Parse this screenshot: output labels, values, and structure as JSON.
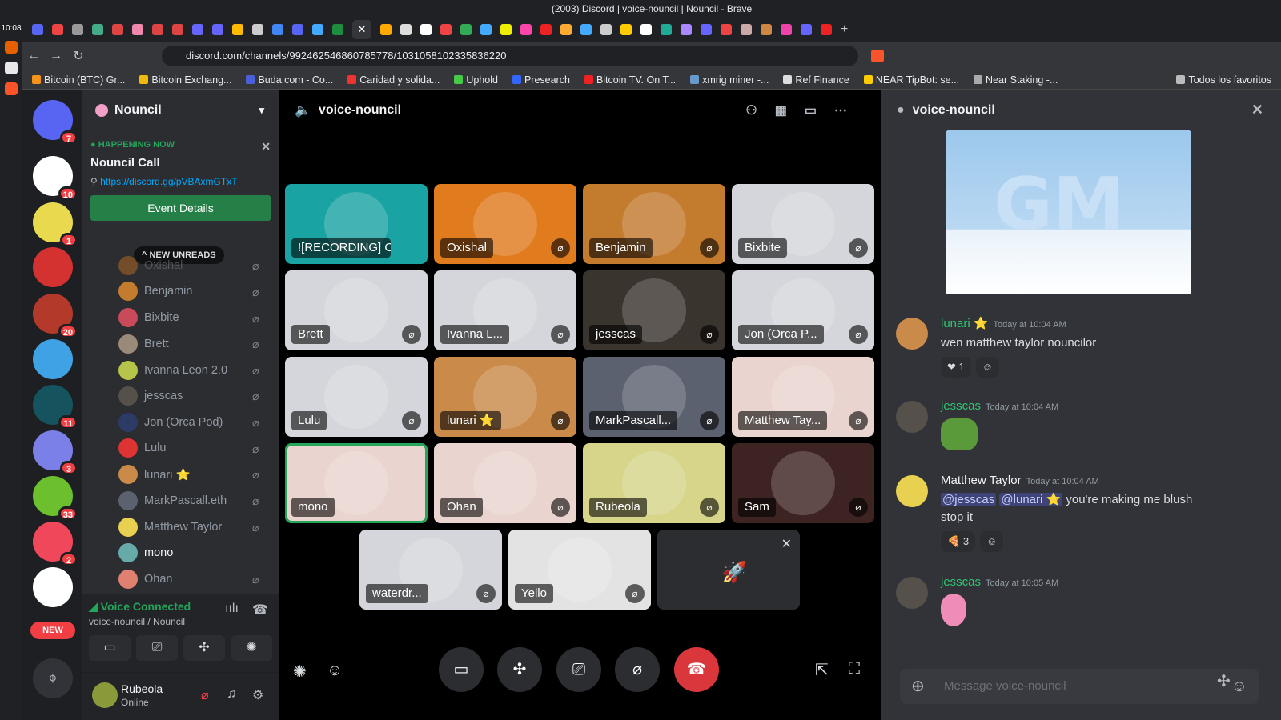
{
  "os": {
    "time": "10:08"
  },
  "browser": {
    "window_title": "(2003) Discord | voice-nouncil | Nouncil - Brave",
    "url": "discord.com/channels/992462546860785778/1031058102335836220",
    "bookmarks": [
      "Bitcoin (BTC) Gr...",
      "Bitcoin Exchang...",
      "Buda.com - Co...",
      "Caridad y solida...",
      "Uphold",
      "Presearch",
      "Bitcoin TV. On T...",
      "xmrig miner -...",
      "Ref Finance",
      "NEAR TipBot: se...",
      "Near Staking -...",
      "Todos los favoritos"
    ],
    "active_tab_icon": "close-icon"
  },
  "guilds": [
    {
      "badge": "7"
    },
    {
      "badge": "10"
    },
    {
      "badge": "1"
    },
    {
      "badge": ""
    },
    {
      "badge": "20"
    },
    {
      "badge": ""
    },
    {
      "badge": "11"
    },
    {
      "badge": "3"
    },
    {
      "badge": "33"
    },
    {
      "badge": "2"
    },
    {
      "badge": ""
    }
  ],
  "guild_new_label": "NEW",
  "sidebar": {
    "server_name": "Nouncil",
    "event": {
      "status": "HAPPENING NOW",
      "name": "Nouncil Call",
      "link": "https://discord.gg/pVBAxmGTxT",
      "button": "Event Details"
    },
    "new_unreads": "NEW UNREADS",
    "members": [
      "Oxishal",
      "Benjamin",
      "Bixbite",
      "Brett",
      "Ivanna Leon 2.0",
      "jesscas",
      "Jon (Orca Pod)",
      "Lulu",
      "lunari ⭐",
      "MarkPascall.eth",
      "Matthew Taylor",
      "mono",
      "Ohan"
    ],
    "voice": {
      "status": "Voice Connected",
      "channel": "voice-nouncil / Nouncil"
    },
    "user": {
      "name": "Rubeola",
      "status": "Online"
    }
  },
  "call": {
    "channel": "voice-nouncil",
    "tiles": [
      {
        "name": "![RECORDING] C...",
        "bg": "#1aa3a3"
      },
      {
        "name": "Oxishal",
        "bg": "#e07b1e"
      },
      {
        "name": "Benjamin",
        "bg": "#c37b2e"
      },
      {
        "name": "Bixbite",
        "bg": "#d4d6db"
      },
      {
        "name": "Brett",
        "bg": "#d4d6db"
      },
      {
        "name": "Ivanna L...",
        "bg": "#d4d6db"
      },
      {
        "name": "jesscas",
        "bg": "#3a342e"
      },
      {
        "name": "Jon (Orca P...",
        "bg": "#d4d6db"
      },
      {
        "name": "Lulu",
        "bg": "#d4d6db"
      },
      {
        "name": "lunari ⭐",
        "bg": "#c98a4a"
      },
      {
        "name": "MarkPascall...",
        "bg": "#5c6170"
      },
      {
        "name": "Matthew Tay...",
        "bg": "#ead4cf"
      },
      {
        "name": "mono",
        "bg": "#ead4cf"
      },
      {
        "name": "Ohan",
        "bg": "#ead4cf"
      },
      {
        "name": "Rubeola",
        "bg": "#d6d58a"
      },
      {
        "name": "Sam",
        "bg": "#3d2422"
      },
      {
        "name": "waterdr...",
        "bg": "#d4d6db"
      },
      {
        "name": "Yello",
        "bg": "#e3e3e3"
      }
    ]
  },
  "chat": {
    "channel": "voice-nouncil",
    "messages": [
      {
        "author": "lunari ⭐",
        "color": "#2dc770",
        "time": "Today at 10:04 AM",
        "text": "wen matthew taylor nouncilor",
        "reactions": [
          "❤ 1"
        ]
      },
      {
        "author": "jesscas",
        "color": "#2dc770",
        "time": "Today at 10:04 AM",
        "text": ""
      },
      {
        "author": "Matthew Taylor",
        "color": "#f2f3f5",
        "time": "Today at 10:04 AM",
        "mention1": "@jesscas",
        "mention2": "@lunari ⭐",
        "text": " you're making me blush stop it",
        "reactions": [
          "3"
        ]
      },
      {
        "author": "jesscas",
        "color": "#2dc770",
        "time": "Today at 10:05 AM",
        "text": ""
      }
    ],
    "composer_placeholder": "Message voice-nouncil"
  }
}
